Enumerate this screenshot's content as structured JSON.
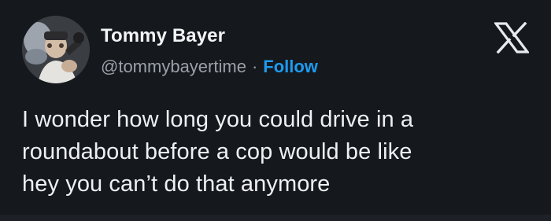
{
  "author": {
    "display_name": "Tommy Bayer",
    "handle": "@tommybayertime",
    "separator": "·",
    "follow_label": "Follow",
    "avatar_icon": "profile-photo"
  },
  "platform": {
    "logo_icon": "x-logo-icon"
  },
  "tweet": {
    "text": "I wonder how long you could drive in a\nroundabout before a cop would be like\nhey you can’t do that anymore"
  },
  "colors": {
    "background": "#15181d",
    "text": "#eef0f2",
    "secondary_text": "#9aa1a8",
    "link": "#1d9bf0"
  }
}
